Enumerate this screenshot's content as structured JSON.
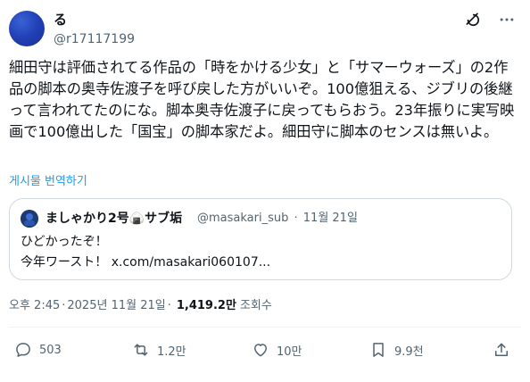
{
  "header": {
    "display_name": "る",
    "handle": "@r17117199",
    "icons": [
      "grok-icon",
      "more-icon"
    ]
  },
  "tweet": {
    "text": "細田守は評価されてる作品の「時をかける少女」と「サマーウォーズ」の2作品の脚本の奥寺佐渡子を呼び戻した方がいいぞ。100億狙える、ジブリの後継って言われてたのにな。脚本奥寺佐渡子に戻ってもらおう。23年振りに実写映画で100億出した「国宝」の脚本家だよ。細田守に脚本のセンスは無いよ。",
    "translate_label": "게시물 번역하기"
  },
  "quote": {
    "name": "ましゃかり2号🍙サブ垢",
    "handle": "@masakari_sub",
    "date": "11월 21일",
    "line1": "ひどかったぞ！",
    "line2": "今年ワースト！ x.com/masakari060107..."
  },
  "meta": {
    "time": "오후 2:45",
    "date": "2025년 11월 21일",
    "views": "1,419.2만",
    "views_label": "조회수"
  },
  "actions": {
    "reply_count": "503",
    "retweet_count": "1.2만",
    "like_count": "10만",
    "bookmark_count": "9.9천"
  },
  "colors": {
    "text": "#0f1419",
    "muted": "#536471",
    "link": "#1d9bf0",
    "border": "#cfd9de"
  }
}
